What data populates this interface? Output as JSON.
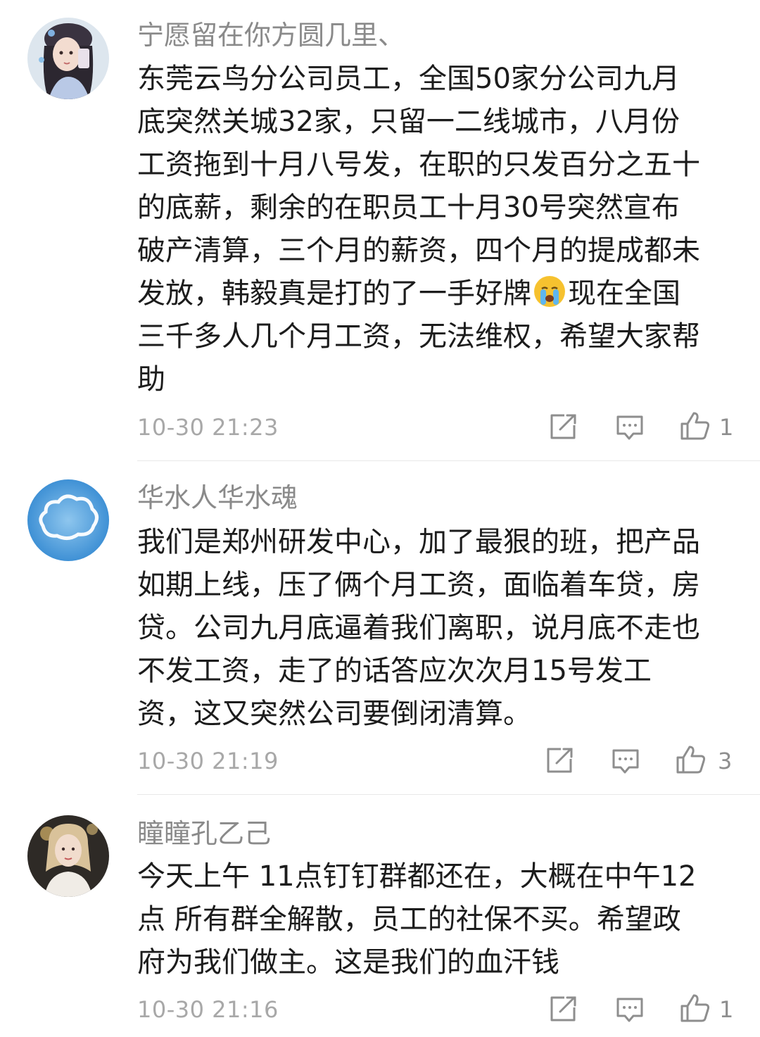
{
  "comments": [
    {
      "username": "宁愿留在你方圆几里、",
      "lines": [
        "东莞云鸟分公司员工，全国50家分公司九月",
        "底突然关城32家，只留一二线城市，八月份",
        "工资拖到十月八号发，在职的只发百分之五十",
        "的底薪，剩余的在职员工十月30号突然宣布",
        "破产清算，三个月的薪资，四个月的提成都未"
      ],
      "line6_before_emoji": "发放，韩毅真是打的了一手好牌",
      "emoji": "crying-face",
      "line6_after_emoji": "现在全国",
      "lines_after": [
        "三千多人几个月工资，无法维权，希望大家帮",
        "助"
      ],
      "time": "10-30 21:23",
      "likes": "1"
    },
    {
      "username": "华水人华水魂",
      "lines": [
        "我们是郑州研发中心，加了最狠的班，把产品",
        "如期上线，压了俩个月工资，面临着车贷，房",
        "贷。公司九月底逼着我们离职，说月底不走也",
        "不发工资，走了的话答应次次月15号发工",
        "资，这又突然公司要倒闭清算。"
      ],
      "time": "10-30 21:19",
      "likes": "3"
    },
    {
      "username": "瞳瞳孔乙己",
      "lines": [
        "今天上午 11点钉钉群都还在，大概在中午12",
        "点  所有群全解散，员工的社保不买。希望政",
        "府为我们做主。这是我们的血汗钱"
      ],
      "time": "10-30 21:16",
      "likes": "1"
    }
  ],
  "icons": {
    "share": "share-icon",
    "reply": "reply-icon",
    "like": "thumbs-up-icon"
  },
  "colors": {
    "username": "#8a8a8a",
    "body": "#1c1c1c",
    "meta": "#a8a8a8",
    "divider": "#e8e8e8"
  }
}
